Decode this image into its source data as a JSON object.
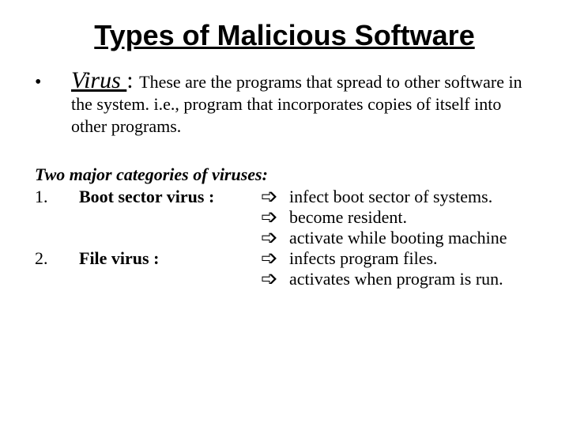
{
  "title": "Types of Malicious Software",
  "bullet_glyph": "•",
  "virus": {
    "term": "Virus ",
    "colon": ": ",
    "definition": "These are the programs that spread to other software in the system. i.e., program that incorporates copies of itself into other programs."
  },
  "categories_heading": "Two major categories of viruses:",
  "arrow": "➩",
  "rows": [
    {
      "num": "1.",
      "name": "Boot sector virus :",
      "desc": "infect boot sector of systems."
    },
    {
      "num": "",
      "name": "",
      "desc": "become resident."
    },
    {
      "num": "",
      "name": "",
      "desc": "activate while booting machine"
    },
    {
      "num": "2.",
      "name": "File virus :",
      "desc": "infects program files."
    },
    {
      "num": "",
      "name": "",
      "desc": "activates when program is run."
    }
  ]
}
